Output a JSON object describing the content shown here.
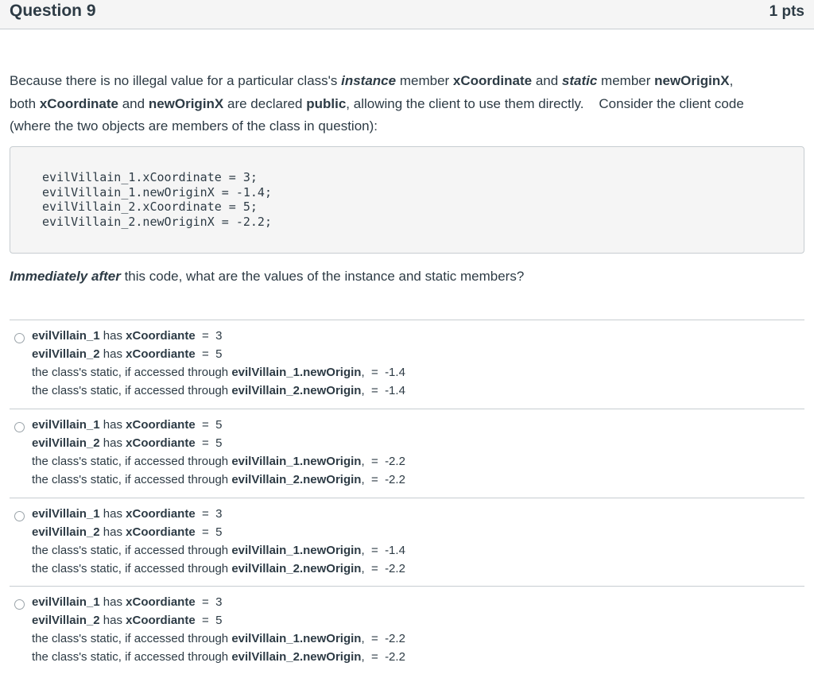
{
  "header": {
    "title": "Question 9",
    "points": "1 pts"
  },
  "question": {
    "p1_a": "Because there is no illegal value for a particular class's ",
    "p1_instance": "instance",
    "p1_b": " member ",
    "p1_xcoord": "xCoordinate",
    "p1_c": " and ",
    "p1_static": "static",
    "p1_d": " member ",
    "p1_neworigin": "newOriginX",
    "p1_e": ",",
    "p2_a": "both ",
    "p2_xcoord": "xCoordinate",
    "p2_b": " and ",
    "p2_neworigin": "newOriginX",
    "p2_c": " are declared ",
    "p2_public": "public",
    "p2_d": ", allowing the client to use them directly.    Consider the client code",
    "p3": "(where the two objects are members of the class in question):"
  },
  "code": [
    "evilVillain_1.xCoordinate = 3;",
    "evilVillain_1.newOriginX = -1.4;",
    "evilVillain_2.xCoordinate = 5;",
    "evilVillain_2.newOriginX = -2.2;"
  ],
  "prompt": {
    "emph": "Immediately after",
    "rest": " this code, what are the values of the instance and static members?"
  },
  "labels": {
    "obj1": "evilVillain_1",
    "obj2": "evilVillain_2",
    "has": " has ",
    "xcoord": "xCoordiante",
    "static_prefix": "the class's static, if accessed through ",
    "obj1_origin": "evilVillain_1.newOrigin",
    "obj2_origin": "evilVillain_2.newOrigin",
    "comma_eq": ",  =  "
  },
  "answers": [
    {
      "x1": "  =  3",
      "x2": "  =  5",
      "s1": "-1.4",
      "s2": "-1.4"
    },
    {
      "x1": "  =  5",
      "x2": "  =  5",
      "s1": "-2.2",
      "s2": "-2.2"
    },
    {
      "x1": "  =  3",
      "x2": "  =  5",
      "s1": "-1.4",
      "s2": "-2.2"
    },
    {
      "x1": "  =  3",
      "x2": "  =  5",
      "s1": "-2.2",
      "s2": "-2.2"
    }
  ]
}
